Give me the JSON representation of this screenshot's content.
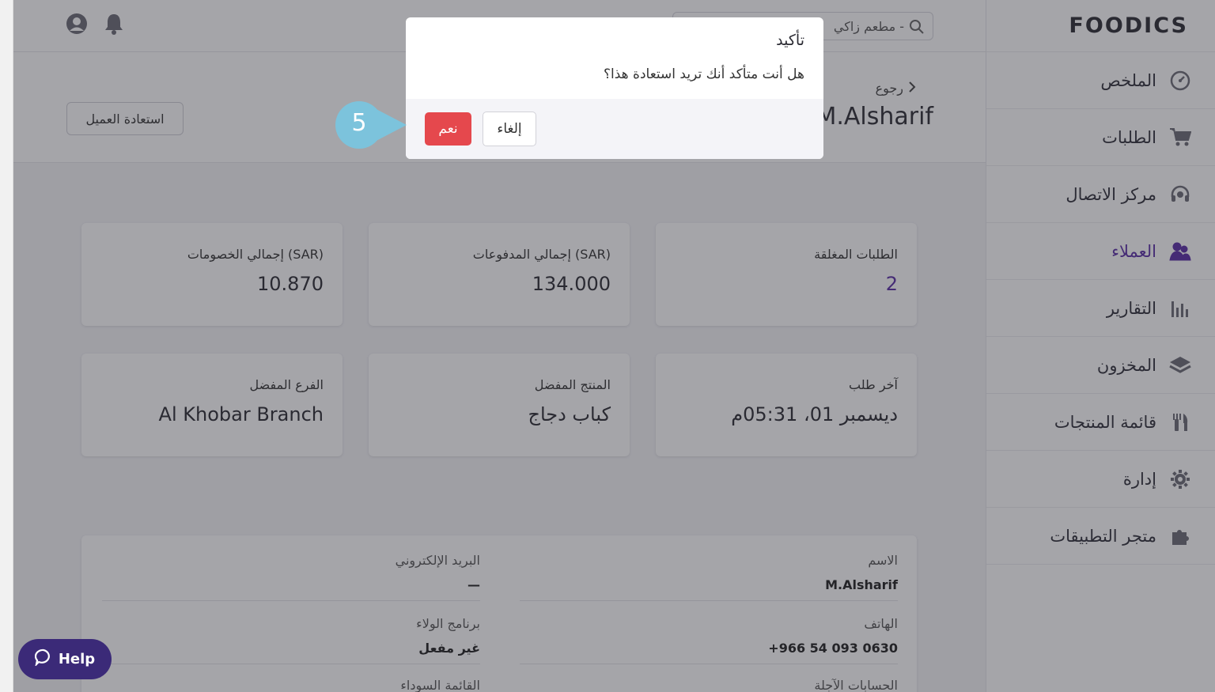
{
  "sidebar": {
    "logo": "FOODICS",
    "items": [
      {
        "label": "الملخص",
        "icon": "dashboard-icon"
      },
      {
        "label": "الطلبات",
        "icon": "cart-icon"
      },
      {
        "label": "مركز الاتصال",
        "icon": "headset-icon"
      },
      {
        "label": "العملاء",
        "icon": "customers-icon",
        "active": true
      },
      {
        "label": "التقارير",
        "icon": "reports-icon"
      },
      {
        "label": "المخزون",
        "icon": "inventory-icon"
      },
      {
        "label": "قائمة المنتجات",
        "icon": "menu-icon"
      },
      {
        "label": "إدارة",
        "icon": "gear-icon"
      },
      {
        "label": "متجر التطبيقات",
        "icon": "puzzle-icon"
      }
    ]
  },
  "topbar": {
    "search_text": "مطعم زاكي -"
  },
  "header": {
    "back_label": "رجوع",
    "customer_name": "M.Alsharif",
    "restore_button": "استعادة العميل"
  },
  "stats": [
    {
      "label": "الطلبات المغلقة",
      "value": "2"
    },
    {
      "label": "إجمالي المدفوعات (SAR)",
      "value": "134.000"
    },
    {
      "label": "إجمالي الخصومات (SAR)",
      "value": "10.870"
    },
    {
      "label": "آخر طلب",
      "value": "ديسمبر 01، 05:31م"
    },
    {
      "label": "المنتج المفضل",
      "value": "كباب دجاج"
    },
    {
      "label": "الفرع المفضل",
      "value": "Al Khobar Branch"
    }
  ],
  "details": {
    "name_label": "الاسم",
    "name_value": "M.Alsharif",
    "email_label": "البريد الإلكتروني",
    "email_value": "—",
    "phone_label": "الهاتف",
    "phone_value": "+966 54 093 0630",
    "loyalty_label": "برنامج الولاء",
    "loyalty_value": "غير مفعل",
    "credit_label": "الحسابات الآجلة",
    "blacklist_label": "القائمة السوداء"
  },
  "help_button": "Help",
  "modal": {
    "title": "تأكيد",
    "message": "هل أنت متأكد أنك تريد استعادة هذا؟",
    "confirm_label": "نعم",
    "cancel_label": "إلغاء"
  },
  "step_badge": "5",
  "colors": {
    "accent": "#5a2ea6",
    "danger": "#e5484d",
    "badge": "#7cc3dc",
    "help": "#3b2a78"
  }
}
